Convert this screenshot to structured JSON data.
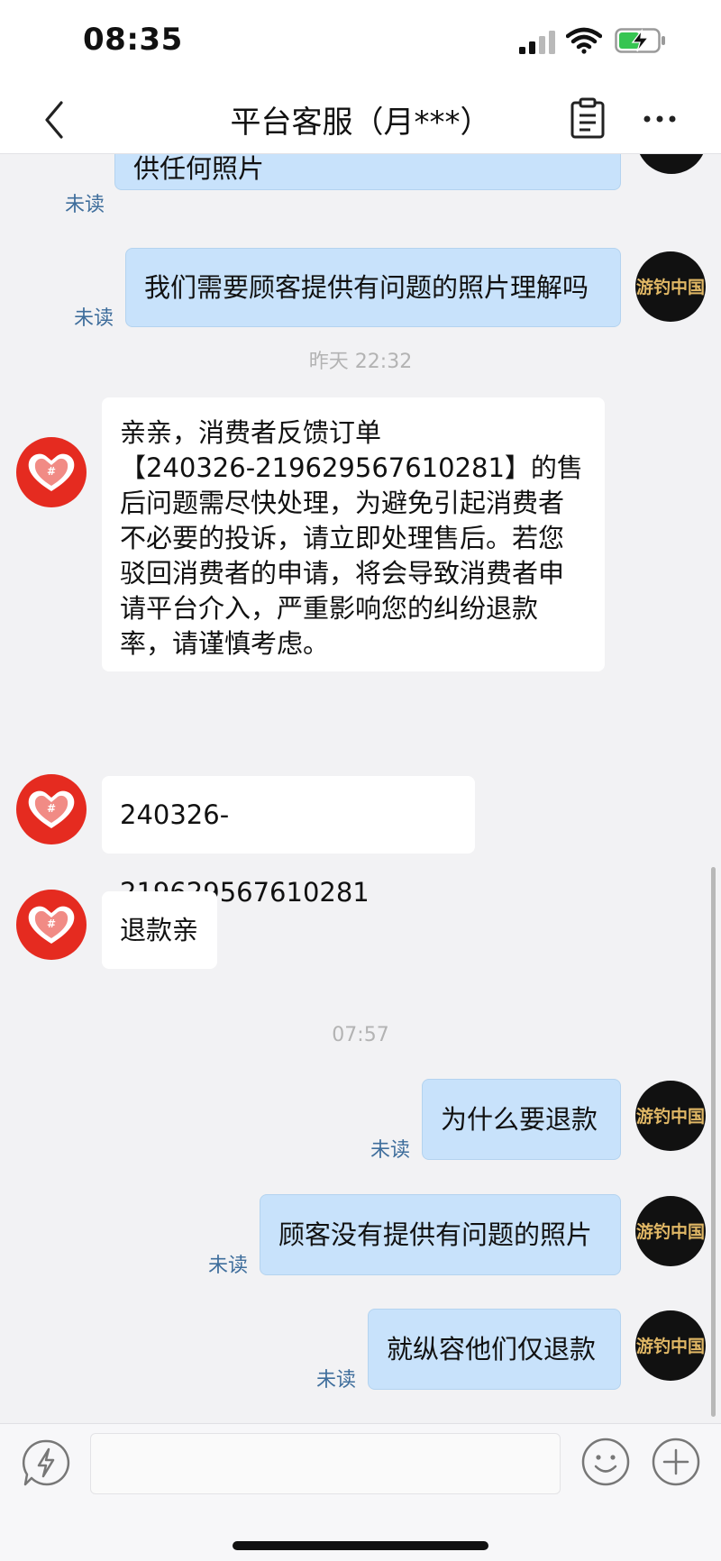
{
  "status_bar": {
    "time": "08:35"
  },
  "header": {
    "title": "平台客服（月***）"
  },
  "chat": {
    "messages": [
      {
        "text": "供任何照片",
        "unread": "未读"
      },
      {
        "text": "我们需要顾客提供有问题的照片理解吗",
        "unread": "未读"
      },
      {
        "timestamp": "昨天 22:32"
      },
      {
        "text": "亲亲，消费者反馈订单\n【240326-219629567610281】的售\n后问题需尽快处理，为避免引起消费者\n不必要的投诉，请立即处理售后。若您\n驳回消费者的申请，将会导致消费者申\n请平台介入，严重影响您的纠纷退款\n率，请谨慎考虑。"
      },
      {
        "text": "240326-219629567610281"
      },
      {
        "text": "退款亲"
      },
      {
        "timestamp": "07:57"
      },
      {
        "text": "为什么要退款",
        "unread": "未读"
      },
      {
        "text": "顾客没有提供有问题的照片",
        "unread": "未读"
      },
      {
        "text": "就纵容他们仅退款",
        "unread": "未读"
      }
    ]
  },
  "shop_avatar": {
    "logo_text": "游钓中国"
  },
  "input": {
    "value": "",
    "placeholder": ""
  },
  "colors": {
    "my_bubble": "#c8e2fb",
    "their_bubble": "#ffffff",
    "unread_text": "#3f6e9c",
    "pdd_red": "#e52b20"
  }
}
